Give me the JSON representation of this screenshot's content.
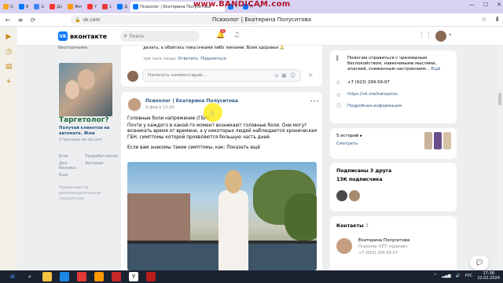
{
  "browser": {
    "tabs": [
      {
        "label": "G",
        "color": "#f5a623"
      },
      {
        "label": "В",
        "color": "#0077ff"
      },
      {
        "label": "G",
        "color": "#4285f4"
      },
      {
        "label": "Дз",
        "color": "#ff3333"
      },
      {
        "label": "Жм",
        "color": "#ff9800"
      },
      {
        "label": "Y",
        "color": "#ff3333"
      },
      {
        "label": "1",
        "color": "#e53935"
      },
      {
        "label": "Д",
        "color": "#0077ff"
      },
      {
        "label": "Психолог | Екатерина Полуситова",
        "color": "#0077ff",
        "active": true
      },
      {
        "label": "Т",
        "color": "#0077ff"
      },
      {
        "label": "П",
        "color": "#0077ff"
      }
    ],
    "watermark": "www.BANDICAM.com",
    "window_controls": [
      "—",
      "☐",
      "✕"
    ],
    "url": "vk.com",
    "page_title": "Психолог | Екатерина Полуситова"
  },
  "vk": {
    "logo_text": "вконтакте",
    "search_placeholder": "Поиск",
    "notifications_count": "3"
  },
  "left": {
    "top_text": "бесплатными",
    "ad_title": "Таргетолог?",
    "ad_line1": "Получай клиентов на автомате. Жми",
    "ad_line2": "Страница на vk.com",
    "footer_links": [
      "Блог",
      "Разработчикам",
      "Для бизнеса",
      "Авторам",
      "Ещё"
    ],
    "applied_text": "Применяются рекомендательные технологии"
  },
  "prev_post": {
    "text": "делать, а обойтись пока очками либо линзами. Всем здоровья 🙏",
    "time": "три часа назад",
    "reply": "Ответить",
    "share": "Поделиться",
    "comment_placeholder": "Написать комментарий..."
  },
  "post": {
    "author": "Психолог | Екатерина Полуситова",
    "date": "9 фев в 12:00",
    "line1": "Головные боли напряжение (ГБН)",
    "line2": "Почти у каждого в какой-то момент возникают головные боли. Они могут возникать время от времени, а у некоторых людей наблюдается хроническая ГБН, симптомы которой проявляются большую часть дней.",
    "line3": "Если вам знакомы такие симптомы, как: Показать ещё"
  },
  "right": {
    "about": "Помогаю справиться с чрезмерным беспокойством, навязчивыми мыслями, апатией, сниженным настроением...",
    "about_more": "Ещё",
    "phone": "+7 (923) 299-59-97",
    "site": "https://vk.me/katepolus",
    "details": "Подробная информация",
    "stories_count": "5 историй ▸",
    "stories_watch": "Смотреть",
    "subs": "Подписаны 3 друга",
    "followers": "13К подписчика",
    "contacts_title": "Контакты",
    "contacts_count": "3",
    "contact_name": "Екатерина Полуситова",
    "contact_role": "Психолог  КПТ терапевт",
    "contact_phone": "+7 (923) 299-59-97"
  },
  "taskbar": {
    "lang": "РУС",
    "time": "17:38",
    "date": "12.02.2024"
  }
}
